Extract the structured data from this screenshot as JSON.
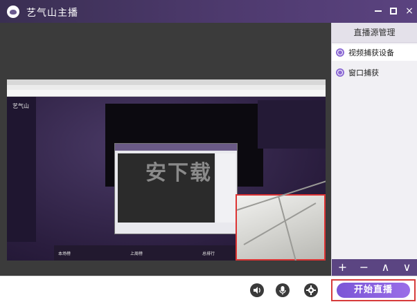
{
  "app": {
    "title": "艺气山主播"
  },
  "window_controls": {
    "minimize": "minimize",
    "maximize": "maximize",
    "close": "×"
  },
  "sidebar": {
    "header": "直播源管理",
    "items": [
      {
        "label": "视频捕获设备",
        "selected": true
      },
      {
        "label": "窗口捕获",
        "selected": false
      }
    ],
    "footer": {
      "add": "+",
      "remove": "−",
      "up": "∧",
      "down": "∨"
    }
  },
  "preview": {
    "site_name": "艺气山",
    "watermark": "安下载",
    "labels": [
      "本场榜",
      "上周榜",
      "总排行"
    ]
  },
  "bottom": {
    "start_button": "开始直播",
    "icons": [
      "speaker-icon",
      "microphone-icon",
      "gear-icon"
    ]
  },
  "colors": {
    "titlebar": "#4e3a6e",
    "accent": "#8c6ad4",
    "start": "#8b62e0",
    "highlight": "#d63a3a"
  }
}
